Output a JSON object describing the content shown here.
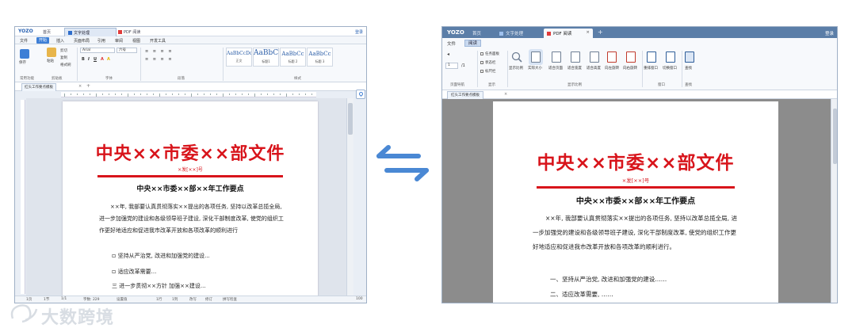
{
  "left": {
    "logo": "YOZO",
    "home": "首页",
    "tab_writer": "文字处理",
    "tab_pdf": "PDF 阅读",
    "login": "登录",
    "menu": [
      "文件",
      "开始",
      "插入",
      "页面布局",
      "引用",
      "审阅",
      "视图",
      "开发工具"
    ],
    "ribbon": {
      "paste": "粘贴",
      "cut": "剪切",
      "copy": "复制",
      "format_painter": "格式刷",
      "font": "Arial",
      "size": "六号",
      "group_common": "常用功能",
      "group_clipboard": "剪贴板",
      "group_font": "字体",
      "group_para": "段落",
      "group_style": "样式",
      "style1_sample": "AaBbCcDd",
      "style1_name": "正文",
      "style2_sample": "AaBbC",
      "style2_name": "标题1",
      "style3_sample": "AaBbCc",
      "style3_name": "标题 2",
      "style4_sample": "AaBbCc",
      "style4_name": "标题 3"
    },
    "doc_tab": "红头工作要点模板",
    "doc": {
      "title": "中央××市委××部文件",
      "number": "×发[××]号",
      "heading": "中央××市委××部××年工作要点",
      "para": "××年, 我部要认真贯彻落实××提出的各项任务, 坚持以改革总揽全局, 进一步加强党的建设和各级领导班子建设, 深化干部制度改革, 使党的组织工作更好地适应和促进我市改革开放和各项改革的顺利进行",
      "item1": "坚持从严治党, 改进和加强党的建设...",
      "item2": "适应改革需要...",
      "item3": "三 进一步贯彻××方针 加强××建设..."
    },
    "status": [
      "1页",
      "1节",
      "1/1",
      "字数: 229",
      "设置值",
      "1行",
      "1列",
      "改写",
      "修订",
      "拼写检查"
    ],
    "zoom": "100"
  },
  "right": {
    "logo": "YOZO",
    "home": "首页",
    "tab_writer": "文字处理",
    "tab_pdf": "PDF 阅读",
    "login": "登录",
    "menu_file": "文件",
    "menu_read": "阅读",
    "ribbon": {
      "page_value": "1",
      "page_total": "/1",
      "chk_bookmark": "任务面板",
      "chk_status": "状态栏",
      "chk_ruler": "标尺栏",
      "show_ratio": "显示比例",
      "actual_size": "实际大小",
      "fit_page": "适合页面",
      "fit_width": "适合宽度",
      "fit_height": "适合高度",
      "rotate_left": "向左旋转",
      "rotate_right": "向右旋转",
      "new_window": "重排窗口",
      "switch_window": "切换窗口",
      "find": "查找",
      "group_nav": "页面导航",
      "group_show": "显示",
      "group_ratio": "显示比例",
      "group_window": "窗口",
      "group_find": "查找"
    },
    "doc_tab": "红头工作要点模板",
    "doc": {
      "title": "中央××市委××部文件",
      "number": "×发[××]号",
      "heading": "中央××市委××部××年工作要点",
      "para": "××年, 我部要认真贯彻落实××提出的各项任务, 坚持以改革总揽全局, 进一步加强党的建设和各级领导班子建设, 深化干部制度改革, 使党的组织工作更好地适应和促进我市改革开放和各项改革的顺利进行。",
      "item1": "一、坚持从严治党, 改进和加强党的建设……",
      "item2": "二、适应改革需要, ……"
    }
  },
  "watermark": "大数跨境",
  "colors": {
    "accent": "#3e7fd6",
    "red": "#d8141b",
    "arrow": "#4a88d4"
  }
}
